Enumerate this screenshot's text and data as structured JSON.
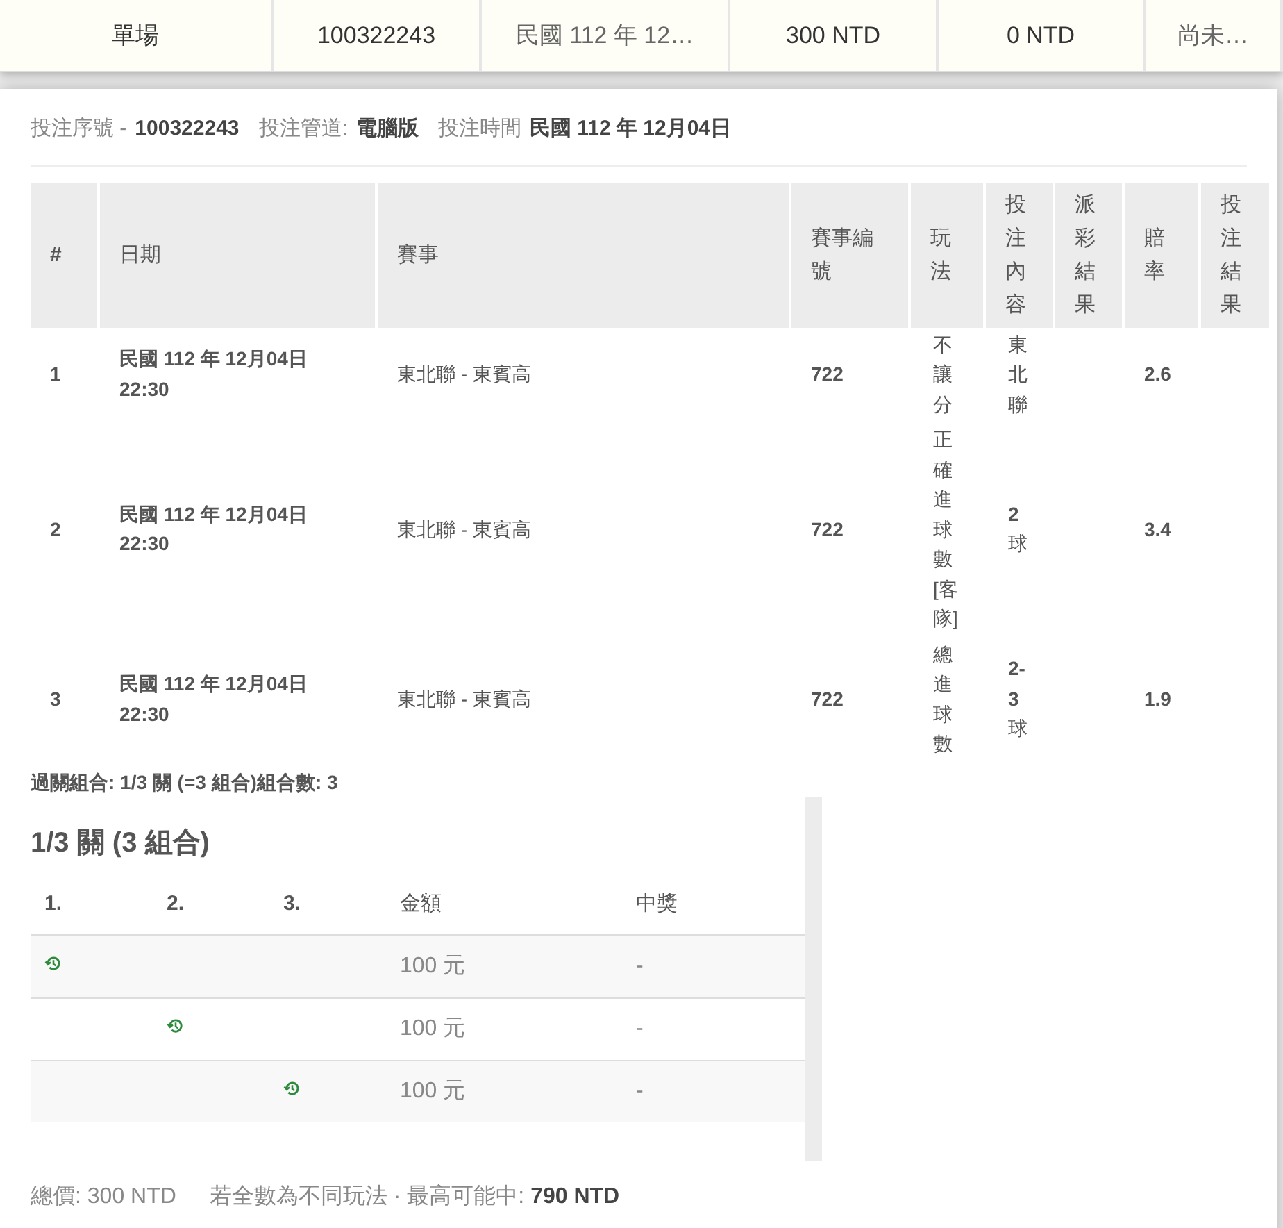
{
  "summary_bar": [
    "單場",
    "100322243",
    "民國 112 年 12…",
    "300 NTD",
    "0 NTD",
    "尚未…"
  ],
  "bet_info": [
    {
      "label": "投注序號 -",
      "value": "100322243"
    },
    {
      "label": "投注管道:",
      "value": "電腦版"
    },
    {
      "label": "投注時間",
      "value": "民國 112 年 12月04日"
    }
  ],
  "table": {
    "columns": [
      "#",
      "日期",
      "賽事",
      "賽事編號",
      "玩法",
      "投注內容",
      "派彩結果",
      "賠率",
      "投注結果"
    ],
    "rows": [
      {
        "no": "1",
        "date": "民國 112 年 12月04日",
        "time": "22:30",
        "match": "東北聯 - 東賓高",
        "match_no": "722",
        "play": "不讓分",
        "selection": "東北聯",
        "odds": "2.6"
      },
      {
        "no": "2",
        "date": "民國 112 年 12月04日",
        "time": "22:30",
        "match": "東北聯 - 東賓高",
        "match_no": "722",
        "play": "正確進球數[客隊]",
        "selection": "**2** 球",
        "odds": "3.4"
      },
      {
        "no": "3",
        "date": "民國 112 年 12月04日",
        "time": "22:30",
        "match": "東北聯 - 東賓高",
        "match_no": "722",
        "play": "總進球數",
        "selection": "**2-3** 球",
        "odds": "1.9"
      }
    ]
  },
  "combo_line": "過關組合: 1/3 關 (=3 組合)組合數: 3",
  "combo": {
    "title": "1/3 關 (3 組合)",
    "columns": [
      "1.",
      "2.",
      "3.",
      "金額",
      "中獎"
    ],
    "rows": [
      {
        "legs": [
          {
            "pending": true
          },
          {
            "pending": false
          },
          {
            "pending": false
          }
        ],
        "amount": "100 元",
        "prize": "-"
      },
      {
        "legs": [
          {
            "pending": false
          },
          {
            "pending": true
          },
          {
            "pending": false
          }
        ],
        "amount": "100 元",
        "prize": "-"
      },
      {
        "legs": [
          {
            "pending": false
          },
          {
            "pending": false
          },
          {
            "pending": true
          }
        ],
        "amount": "100 元",
        "prize": "-"
      }
    ]
  },
  "footer": {
    "total_label": "總價:",
    "total": "300 NTD",
    "max_label": "若全數為不同玩法 · 最高可能中:",
    "max": "790 NTD"
  }
}
